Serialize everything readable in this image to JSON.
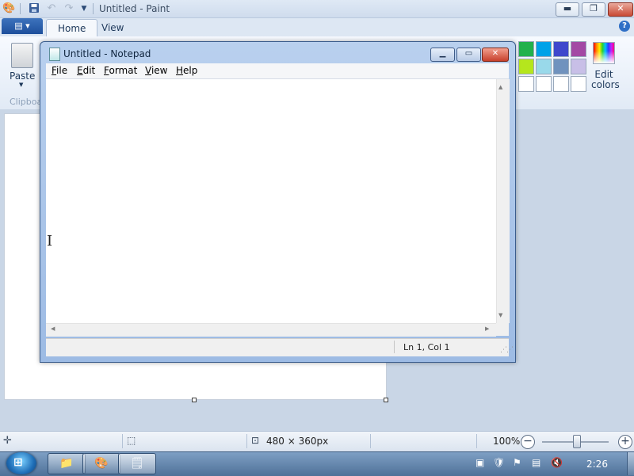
{
  "paint": {
    "title": "Untitled - Paint",
    "quick_access": {
      "save_icon": "save-icon",
      "undo_icon": "undo-icon",
      "redo_icon": "redo-icon",
      "customize_icon": "dropdown-icon"
    },
    "tabs": [
      {
        "label": "Home"
      },
      {
        "label": "View"
      }
    ],
    "clipboard": {
      "paste_label": "Paste",
      "group_label": "Clipboa"
    },
    "colors": {
      "row1": [
        "#22b14c",
        "#00a2e8",
        "#3f48cc",
        "#a349a4"
      ],
      "row2": [
        "#b5e61d",
        "#99d9ea",
        "#7092be",
        "#c8bfe7"
      ],
      "row3": [
        "#ffffff",
        "#ffffff",
        "#ffffff",
        "#ffffff"
      ]
    },
    "edit_colors_label": "Edit colors",
    "status": {
      "size": "480 × 360px",
      "zoom": "100%",
      "zoom_out": "−",
      "zoom_in": "+"
    }
  },
  "notepad": {
    "title": "Untitled - Notepad",
    "menu": [
      {
        "label": "File"
      },
      {
        "label": "Edit"
      },
      {
        "label": "Format"
      },
      {
        "label": "View"
      },
      {
        "label": "Help"
      }
    ],
    "text": "",
    "status": {
      "position": "Ln 1, Col 1"
    }
  },
  "taskbar": {
    "clock": "2:26"
  }
}
